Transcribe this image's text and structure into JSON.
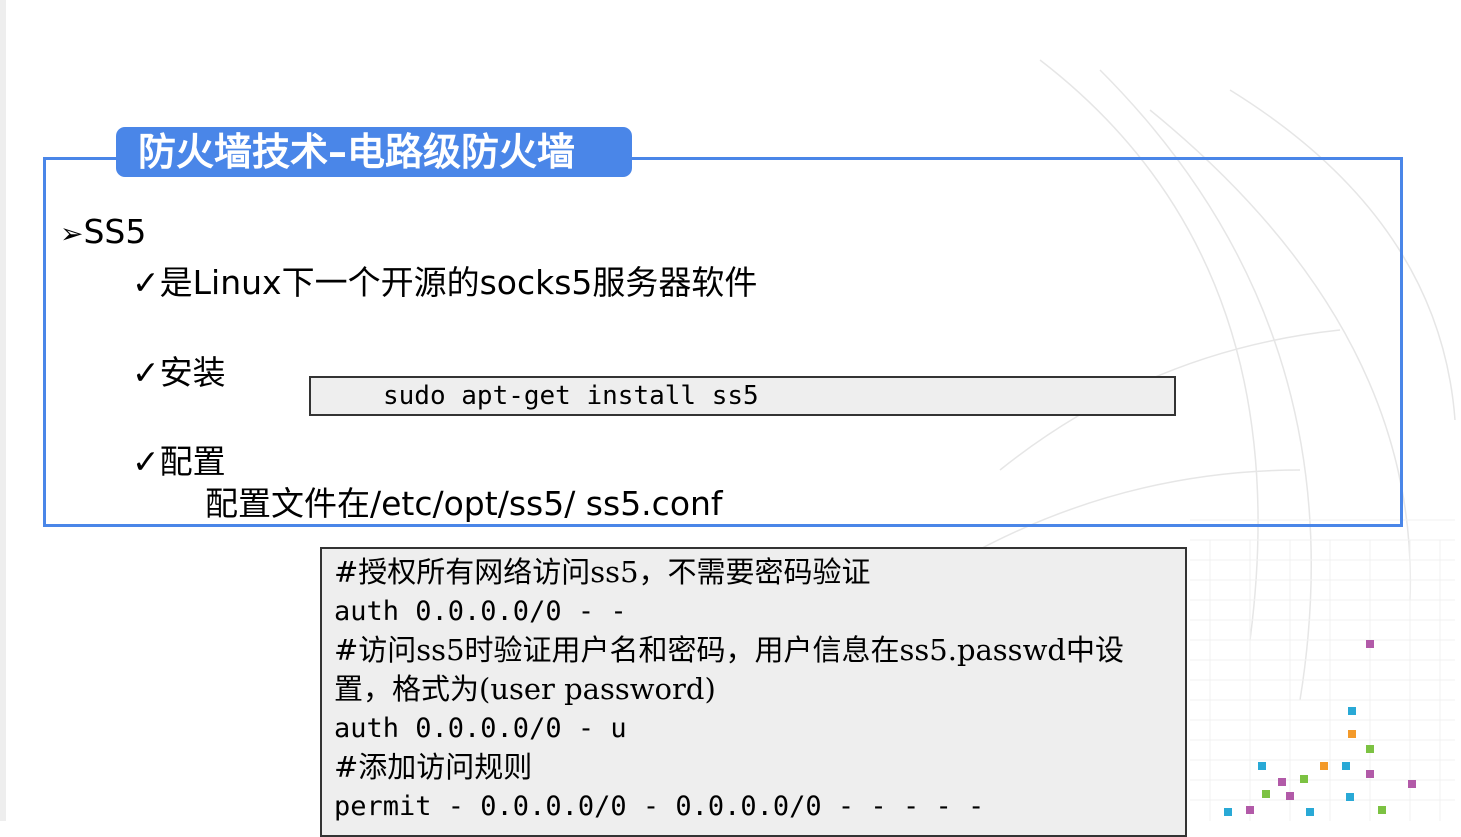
{
  "slide": {
    "title": "防火墙技术–电路级防火墙",
    "bullet": {
      "marker": "➢",
      "text": "SS5"
    },
    "items": [
      {
        "marker": "✓",
        "text": "是Linux下一个开源的socks5服务器软件"
      },
      {
        "marker": "✓",
        "text": "安装"
      },
      {
        "marker": "✓",
        "text": "配置"
      }
    ],
    "install_command": "sudo apt-get install ss5",
    "config_path": "配置文件在/etc/opt/ss5/ ss5.conf",
    "config_lines": [
      "#授权所有网络访问ss5，不需要密码验证",
      "auth 0.0.0.0/0 -  -",
      "#访问ss5时验证用户名和密码，用户信息在ss5.passwd中设",
      "置，格式为(user password)",
      "auth 0.0.0.0/0 - u",
      "#添加访问规则",
      "permit - 0.0.0.0/0 - 0.0.0.0/0 - - - - -"
    ]
  },
  "colors": {
    "accent": "#4a86e8",
    "code_bg": "#eeeeee"
  }
}
